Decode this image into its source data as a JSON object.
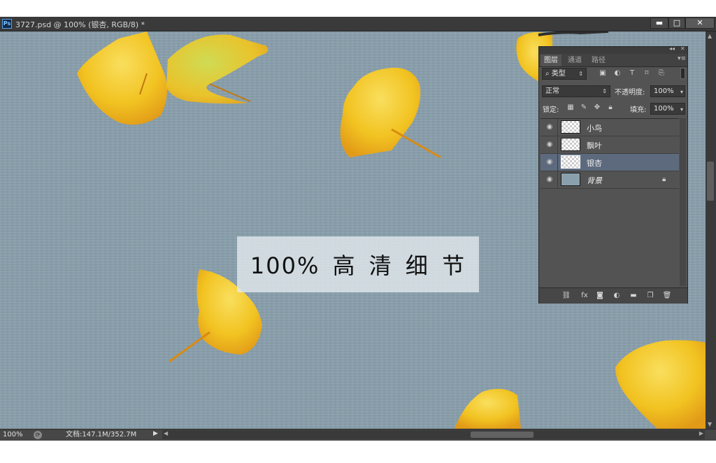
{
  "window": {
    "title": "3727.psd @ 100% (银杏, RGB/8) *",
    "app_icon": "Ps",
    "controls": {
      "minimize": "▬",
      "maximize": "□",
      "close": "✕"
    }
  },
  "canvas": {
    "caption": "100% 高 清 细 节",
    "background_color": "#8aa0ad",
    "leaf_colors": [
      "#f7c51a",
      "#ffe04a",
      "#e69a10",
      "#b8d038"
    ]
  },
  "layers_panel": {
    "tabs": [
      "图层",
      "通道",
      "路径"
    ],
    "active_tab": "图层",
    "filter_kind": "类型",
    "filter_icons": [
      "image-filter-icon",
      "adjustment-filter-icon",
      "type-filter-icon",
      "shape-filter-icon",
      "smart-object-filter-icon"
    ],
    "blend_mode": "正常",
    "opacity_label": "不透明度:",
    "opacity_value": "100%",
    "lock_label": "锁定:",
    "fill_label": "填充:",
    "fill_value": "100%",
    "layers": [
      {
        "name": "小鸟",
        "visible": true,
        "selected": false,
        "locked": false
      },
      {
        "name": "飘叶",
        "visible": true,
        "selected": false,
        "locked": false
      },
      {
        "name": "银杏",
        "visible": true,
        "selected": true,
        "locked": false
      },
      {
        "name": "背景",
        "visible": true,
        "selected": false,
        "locked": true
      }
    ],
    "selection_color": "#5d6a7e"
  },
  "statusbar": {
    "zoom": "100%",
    "doc_size": "文档:147.1M/352.7M"
  }
}
